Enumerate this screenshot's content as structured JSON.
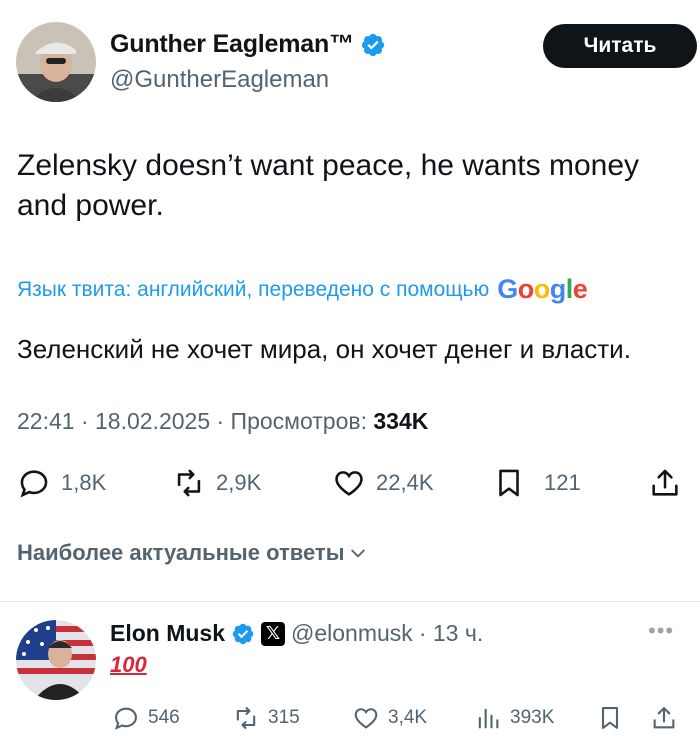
{
  "tweet": {
    "author": {
      "name": "Gunther Eagleman™",
      "handle": "@GuntherEagleman"
    },
    "follow_label": "Читать",
    "text": "Zelensky doesn’t want peace, he wants money and power.",
    "translation_label": "Язык твита: английский, переведено с помощью",
    "translated_text": "Зеленский не хочет мира, он хочет денег и власти.",
    "timestamp": "22:41 · 18.02.2025 · Просмотров:",
    "views": "334K",
    "stats": {
      "replies": "1,8K",
      "retweets": "2,9K",
      "likes": "22,4K",
      "bookmarks": "121"
    },
    "top_replies_label": "Наиболее актуальные ответы"
  },
  "reply": {
    "name": "Elon Musk",
    "x_badge": "𝕏",
    "handle": "@elonmusk",
    "time": "· 13 ч.",
    "text": "💯",
    "stats": {
      "replies": "546",
      "retweets": "315",
      "likes": "3,4K",
      "views": "393K"
    }
  },
  "colors": {
    "accent": "#1d9bf0",
    "muted": "#536471",
    "text": "#0f1419"
  }
}
